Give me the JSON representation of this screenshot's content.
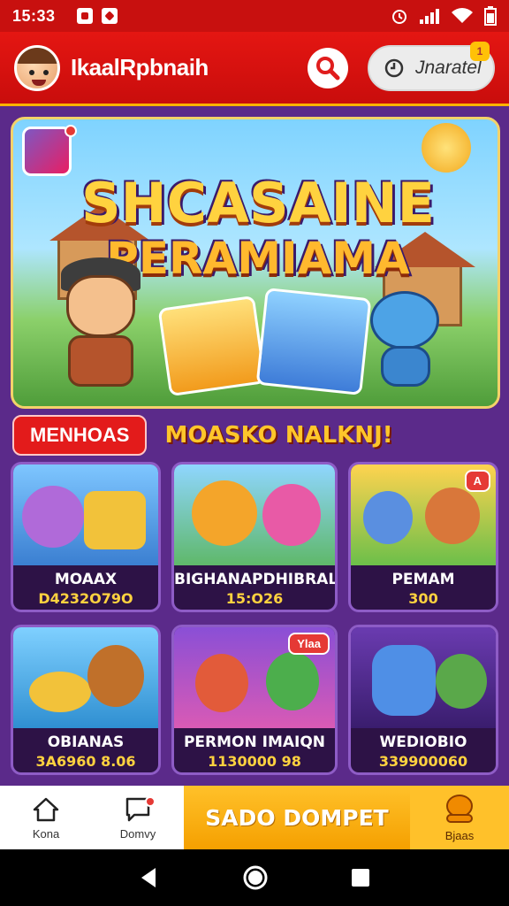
{
  "status_bar": {
    "time": "15:33"
  },
  "header": {
    "username": "IkaalRpbnaih",
    "account_label": "Jnaratel",
    "account_badge": "1"
  },
  "banner": {
    "title_line1": "SHCASAINE",
    "title_line2": "PERAMIAMA"
  },
  "section": {
    "pill_label": "MENHOAS",
    "title": "MOASKO NALKNJ!"
  },
  "games": [
    {
      "name": "MOAAX",
      "value": "D4232O79O",
      "badge": ""
    },
    {
      "name": "BIGHANAPDHIBRAL",
      "value": "15:O26",
      "badge": ""
    },
    {
      "name": "PEMAM",
      "value": "300",
      "badge": "A"
    },
    {
      "name": "OBIANAS",
      "value": "3A6960 8.06",
      "badge": ""
    },
    {
      "name": "PERMON IMAIQN",
      "value": "1130000 98",
      "badge": "Ylaa"
    },
    {
      "name": "WEDIOBIO",
      "value": "339900060",
      "badge": ""
    }
  ],
  "bottom_nav": {
    "home_label": "Kona",
    "messages_label": "Domvy",
    "wallet_label": "SADO DOMPET",
    "right_label": "Bjaas"
  },
  "colors": {
    "primary_red": "#d4100f",
    "accent_yellow": "#ffc12a",
    "background_purple": "#5b2a8a"
  }
}
